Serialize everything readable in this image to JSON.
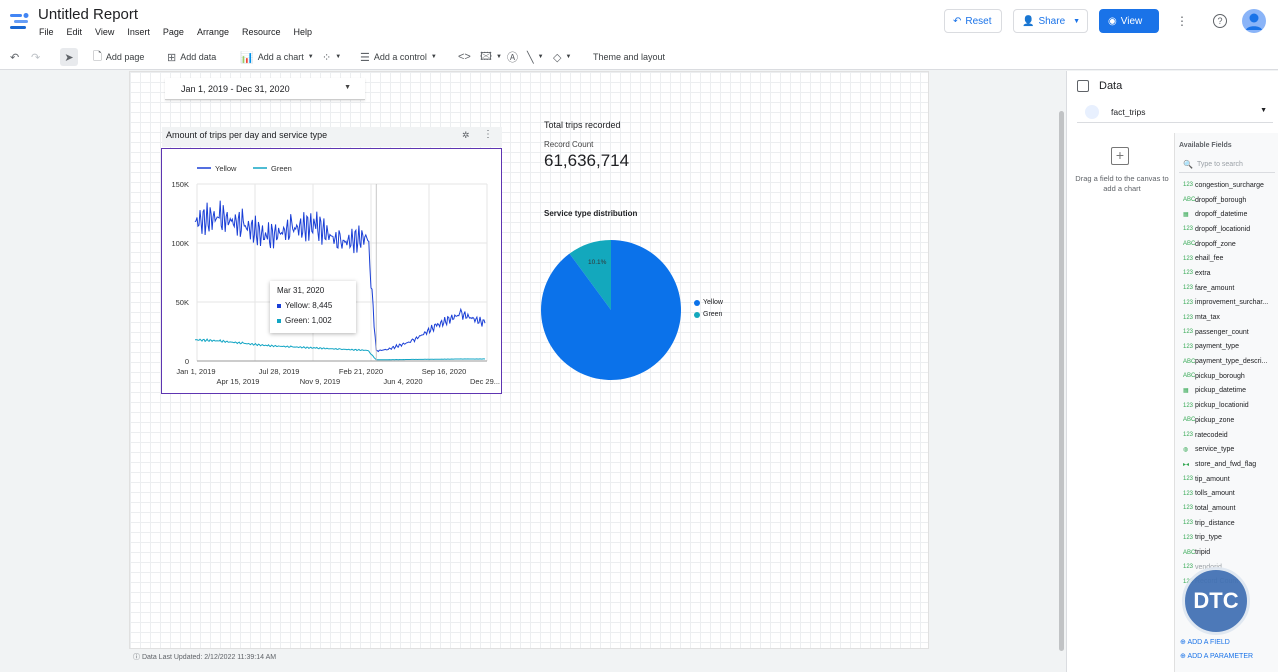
{
  "app": {
    "title": "Untitled Report"
  },
  "menu": [
    "File",
    "Edit",
    "View",
    "Insert",
    "Page",
    "Arrange",
    "Resource",
    "Help"
  ],
  "header_buttons": {
    "reset": "Reset",
    "share": "Share",
    "view": "View"
  },
  "toolbar": {
    "add_page": "Add page",
    "add_data": "Add data",
    "add_chart": "Add a chart",
    "add_control": "Add a control",
    "theme": "Theme and layout"
  },
  "date_control": {
    "value": "Jan 1, 2019 - Dec 31, 2020"
  },
  "chart": {
    "header": "Amount of trips per day and service type"
  },
  "chart_data": [
    {
      "type": "line",
      "title": "Amount of trips per day and service type",
      "x_ticks_row1": [
        "Jan 1, 2019",
        "Jul 28, 2019",
        "Feb 21, 2020",
        "Sep 16, 2020"
      ],
      "x_ticks_row2": [
        "Apr 15, 2019",
        "Nov 9, 2019",
        "Jun 4, 2020",
        "Dec 29..."
      ],
      "y_ticks": [
        "150K",
        "100K",
        "50K",
        "0"
      ],
      "ylim": [
        0,
        150000
      ],
      "legend": "top-left",
      "grid": true,
      "series": [
        {
          "name": "Yellow",
          "color": "#1a3fd6",
          "x": [
            "2019-01",
            "2019-03",
            "2019-05",
            "2019-07",
            "2019-09",
            "2019-11",
            "2020-01",
            "2020-03-10",
            "2020-03-31",
            "2020-05",
            "2020-07",
            "2020-09",
            "2020-11",
            "2020-12-29"
          ],
          "values": [
            118000,
            122000,
            115000,
            105000,
            112000,
            115000,
            100000,
            105000,
            8445,
            10000,
            17000,
            30000,
            40000,
            32000
          ]
        },
        {
          "name": "Green",
          "color": "#12a5c4",
          "x": [
            "2019-01",
            "2019-03",
            "2019-05",
            "2019-07",
            "2019-09",
            "2019-11",
            "2020-01",
            "2020-03-10",
            "2020-03-31",
            "2020-05",
            "2020-07",
            "2020-09",
            "2020-11",
            "2020-12-29"
          ],
          "values": [
            18000,
            17000,
            15000,
            13000,
            12000,
            11000,
            10000,
            9000,
            1002,
            1100,
            1300,
            1500,
            1700,
            1700
          ]
        }
      ]
    },
    {
      "type": "pie",
      "title": "Service type distribution",
      "legend": "right",
      "slices": [
        {
          "label": "Yellow",
          "value": 89.9,
          "color": "#0b72ea"
        },
        {
          "label": "Green",
          "value": 10.1,
          "color": "#13a8bd"
        }
      ],
      "labels": [
        "89.9%",
        "10.1%"
      ]
    }
  ],
  "tooltip": {
    "date": "Mar 31, 2020",
    "yellow": "Yellow: 8,445",
    "green": "Green: 1,002"
  },
  "scorecard": {
    "title": "Total trips recorded",
    "label": "Record Count",
    "value": "61,636,714"
  },
  "data_panel": {
    "title": "Data",
    "source": "fact_trips",
    "drag_hint": "Drag a field to the canvas to add a chart",
    "available_label": "Available Fields",
    "search_placeholder": "Type to search",
    "fields": [
      {
        "type": "123",
        "name": "congestion_surcharge"
      },
      {
        "type": "ABC",
        "name": "dropoff_borough"
      },
      {
        "type": "cal",
        "name": "dropoff_datetime"
      },
      {
        "type": "123",
        "name": "dropoff_locationid"
      },
      {
        "type": "ABC",
        "name": "dropoff_zone"
      },
      {
        "type": "123",
        "name": "ehail_fee"
      },
      {
        "type": "123",
        "name": "extra"
      },
      {
        "type": "123",
        "name": "fare_amount"
      },
      {
        "type": "123",
        "name": "improvement_surchar..."
      },
      {
        "type": "123",
        "name": "mta_tax"
      },
      {
        "type": "123",
        "name": "passenger_count"
      },
      {
        "type": "123",
        "name": "payment_type"
      },
      {
        "type": "ABC",
        "name": "payment_type_descri..."
      },
      {
        "type": "ABC",
        "name": "pickup_borough"
      },
      {
        "type": "cal",
        "name": "pickup_datetime"
      },
      {
        "type": "123",
        "name": "pickup_locationid"
      },
      {
        "type": "ABC",
        "name": "pickup_zone"
      },
      {
        "type": "123",
        "name": "ratecodeid"
      },
      {
        "type": "geo",
        "name": "service_type"
      },
      {
        "type": "bool",
        "name": "store_and_fwd_flag"
      },
      {
        "type": "123",
        "name": "tip_amount"
      },
      {
        "type": "123",
        "name": "tolls_amount"
      },
      {
        "type": "123",
        "name": "total_amount"
      },
      {
        "type": "123",
        "name": "trip_distance"
      },
      {
        "type": "123",
        "name": "trip_type"
      },
      {
        "type": "ABC",
        "name": "tripid"
      },
      {
        "type": "123",
        "name": "vendorid"
      },
      {
        "type": "123",
        "name": "Record Count"
      }
    ],
    "add_field": "ADD A FIELD",
    "add_parameter": "ADD A PARAMETER"
  },
  "footer": {
    "last_updated": "Data Last Updated: 2/12/2022 11:39:14 AM"
  },
  "badge": {
    "text": "DTC"
  }
}
